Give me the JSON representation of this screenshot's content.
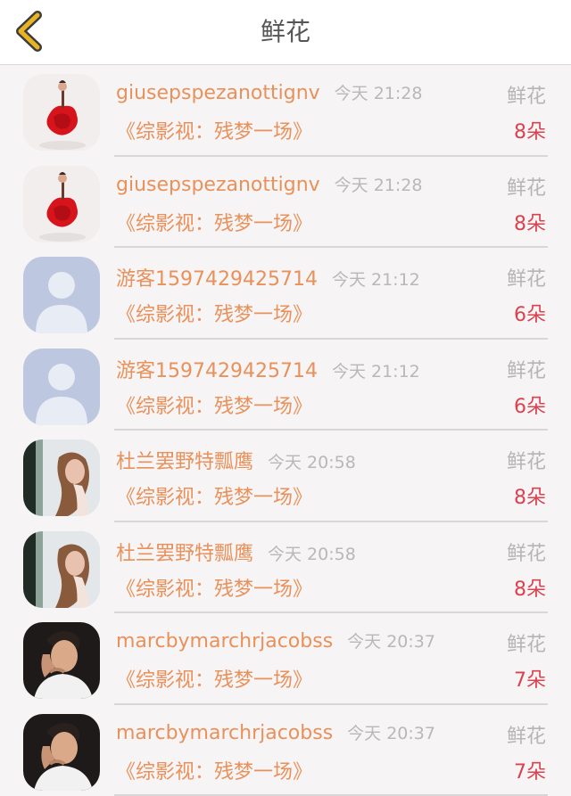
{
  "header": {
    "title": "鲜花",
    "back_icon": "chevron-left-icon",
    "accent_color": "#e8b325"
  },
  "records": [
    {
      "name": "giusepspezanottignv",
      "time": "今天 21:28",
      "category": "鲜花",
      "work": "《综影视：残梦一场》",
      "count": "8朵",
      "avatar": "rose-doll-avatar"
    },
    {
      "name": "giusepspezanottignv",
      "time": "今天 21:28",
      "category": "鲜花",
      "work": "《综影视：残梦一场》",
      "count": "8朵",
      "avatar": "rose-doll-avatar"
    },
    {
      "name": "游客1597429425714",
      "time": "今天 21:12",
      "category": "鲜花",
      "work": "《综影视：残梦一场》",
      "count": "6朵",
      "avatar": "default-user-avatar"
    },
    {
      "name": "游客1597429425714",
      "time": "今天 21:12",
      "category": "鲜花",
      "work": "《综影视：残梦一场》",
      "count": "6朵",
      "avatar": "default-user-avatar"
    },
    {
      "name": "杜兰罢野特瓢鹰",
      "time": "今天 20:58",
      "category": "鲜花",
      "work": "《综影视：残梦一场》",
      "count": "8朵",
      "avatar": "woman-portrait-avatar"
    },
    {
      "name": "杜兰罢野特瓢鹰",
      "time": "今天 20:58",
      "category": "鲜花",
      "work": "《综影视：残梦一场》",
      "count": "8朵",
      "avatar": "woman-portrait-avatar"
    },
    {
      "name": "marcbymarchrjacobss",
      "time": "今天 20:37",
      "category": "鲜花",
      "work": "《综影视：残梦一场》",
      "count": "7朵",
      "avatar": "man-portrait-avatar"
    },
    {
      "name": "marcbymarchrjacobss",
      "time": "今天 20:37",
      "category": "鲜花",
      "work": "《综影视：残梦一场》",
      "count": "7朵",
      "avatar": "man-portrait-avatar"
    }
  ],
  "colors": {
    "name": "#e8915a",
    "count": "#d9434f",
    "muted": "#b5b5b5"
  }
}
